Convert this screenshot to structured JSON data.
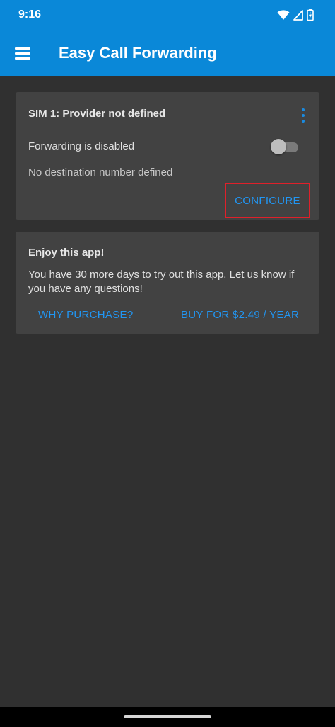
{
  "status_bar": {
    "time": "9:16",
    "icons": [
      "wifi-icon",
      "signal-icon",
      "battery-charging-icon"
    ]
  },
  "app_bar": {
    "title": "Easy Call Forwarding",
    "menu_icon": "hamburger-menu-icon",
    "color": "#0a88d8"
  },
  "sim_card": {
    "title": "SIM 1: Provider not defined",
    "overflow_icon": "more-vert-icon",
    "forwarding_label": "Forwarding is disabled",
    "forwarding_enabled": false,
    "destination_text": "No destination number defined",
    "configure_label": "CONFIGURE"
  },
  "promo_card": {
    "title": "Enjoy this app!",
    "message": "You have 30 more days to try out this app. Let us know if you have any questions!",
    "why_purchase_label": "WHY PURCHASE?",
    "buy_label": "BUY FOR $2.49 / YEAR"
  },
  "colors": {
    "background": "#303030",
    "card": "#424242",
    "accent": "#2196f3",
    "highlight_border": "#e0202a"
  }
}
